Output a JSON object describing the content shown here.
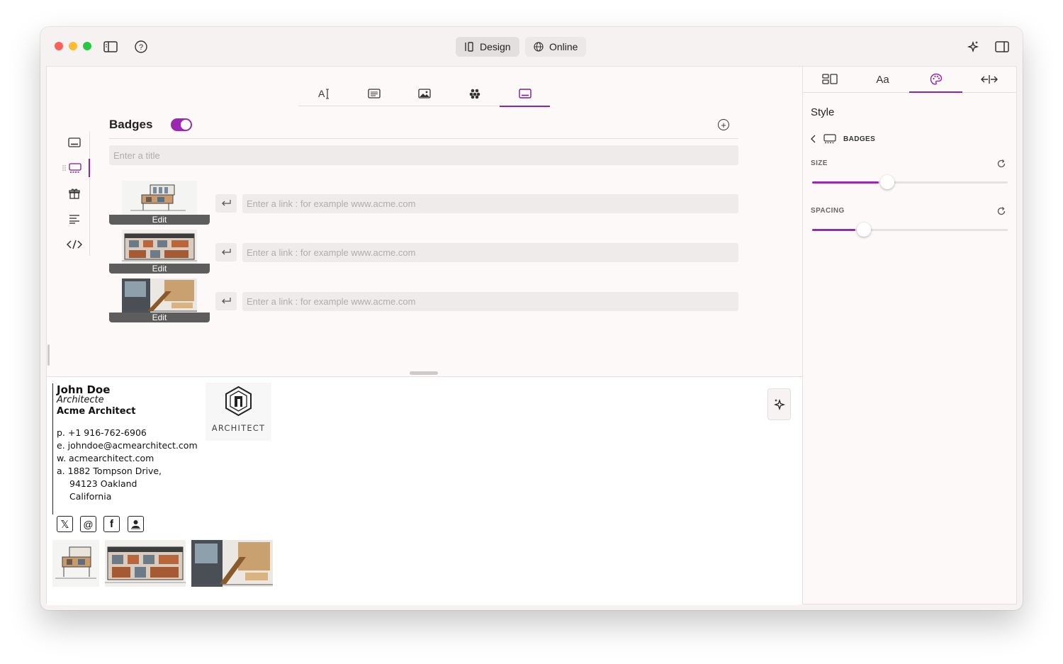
{
  "window": {
    "colors": {
      "accent": "#8e24aa",
      "close": "#fe5f57",
      "minimize": "#febc2e",
      "maximize": "#28c840"
    }
  },
  "toolbar": {
    "design_label": "Design",
    "online_label": "Online"
  },
  "editor": {
    "top_tabs": [
      "text-icon",
      "layout-icon",
      "image-icon",
      "apps-icon",
      "badge-icon"
    ],
    "active_tab": "badge-icon",
    "side_nav": [
      "badge-icon",
      "gallery-icon",
      "gift-icon",
      "paragraph-icon",
      "code-icon"
    ],
    "section_title": "Badges",
    "toggle_on": true,
    "title_placeholder": "Enter a title",
    "badges": [
      {
        "edit_label": "Edit",
        "link_placeholder": "Enter a link : for example www.acme.com"
      },
      {
        "edit_label": "Edit",
        "link_placeholder": "Enter a link : for example www.acme.com"
      },
      {
        "edit_label": "Edit",
        "link_placeholder": "Enter a link : for example www.acme.com"
      }
    ]
  },
  "signature": {
    "name": "John Doe",
    "role": "Architecte",
    "company": "Acme Architect",
    "phone_prefix": "p.",
    "phone": "+1 916-762-6906",
    "email_prefix": "e.",
    "email": "johndoe@acmearchitect.com",
    "web_prefix": "w.",
    "web": "acmearchitect.com",
    "address_prefix": "a.",
    "address_line1": "1882 Tompson Drive,",
    "address_line2": "94123 Oakland",
    "address_line3": "California",
    "logo_text": "ARCHITECT",
    "social": [
      "x-icon",
      "threads-icon",
      "facebook-icon",
      "contact-icon"
    ]
  },
  "style_panel": {
    "tabs": [
      "layout-icon",
      "Aa",
      "palette-icon",
      "spacing-icon"
    ],
    "active_tab": "palette-icon",
    "title": "Style",
    "breadcrumb": "BADGES",
    "size_label": "SIZE",
    "size_value": 0.34,
    "spacing_label": "SPACING",
    "spacing_value": 0.22
  }
}
